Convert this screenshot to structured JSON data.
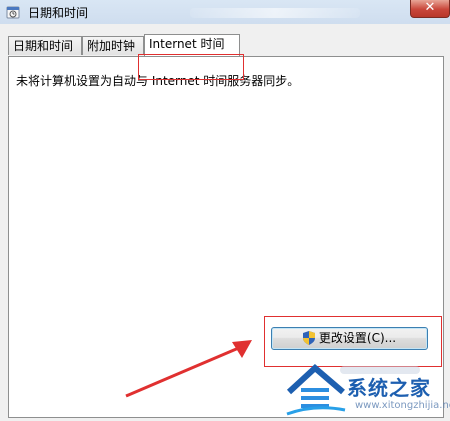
{
  "window": {
    "title": "日期和时间",
    "close_label": "✕"
  },
  "tabs": [
    {
      "label": "日期和时间"
    },
    {
      "label": "附加时钟"
    },
    {
      "label": "Internet 时间",
      "active": true
    }
  ],
  "internet_time": {
    "status_message": "未将计算机设置为自动与 Internet 时间服务器同步。",
    "change_settings_label": "更改设置(C)..."
  },
  "watermark": {
    "brand": "系统之家",
    "url": "www.xitongzhijia.net"
  },
  "colors": {
    "highlight_box": "#e03030",
    "arrow": "#e03030",
    "watermark": "#1d5fb0"
  },
  "icons": [
    "app-clock-icon",
    "close-icon",
    "uac-shield-icon",
    "arrow-annotation",
    "watermark-house-logo"
  ]
}
